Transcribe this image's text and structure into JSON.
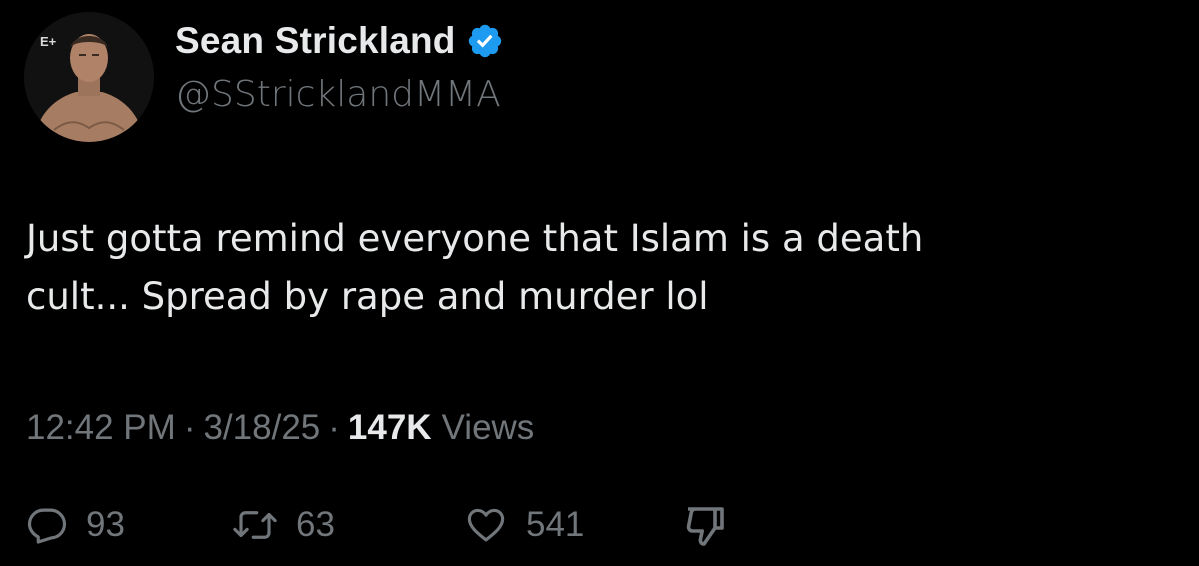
{
  "author": {
    "display_name": "Sean Strickland",
    "handle": "@SStricklandMMA",
    "verified_icon": "verified-badge-icon",
    "verified_color": "#1d9bf0",
    "avatar_logo": "E+"
  },
  "tweet": {
    "text": "Just gotta remind everyone that Islam is a death\ncult... Spread by rape and murder lol"
  },
  "meta": {
    "time": "12:42 PM",
    "separator": "·",
    "date": "3/18/25",
    "views_count": "147K",
    "views_label": "Views"
  },
  "actions": {
    "reply_count": "93",
    "retweet_count": "63",
    "like_count": "541",
    "icons": [
      "reply-icon",
      "retweet-icon",
      "like-icon",
      "dislike-icon"
    ]
  },
  "colors": {
    "background": "#000000",
    "primary_text": "#e7e9ea",
    "secondary_text": "#71767b"
  }
}
